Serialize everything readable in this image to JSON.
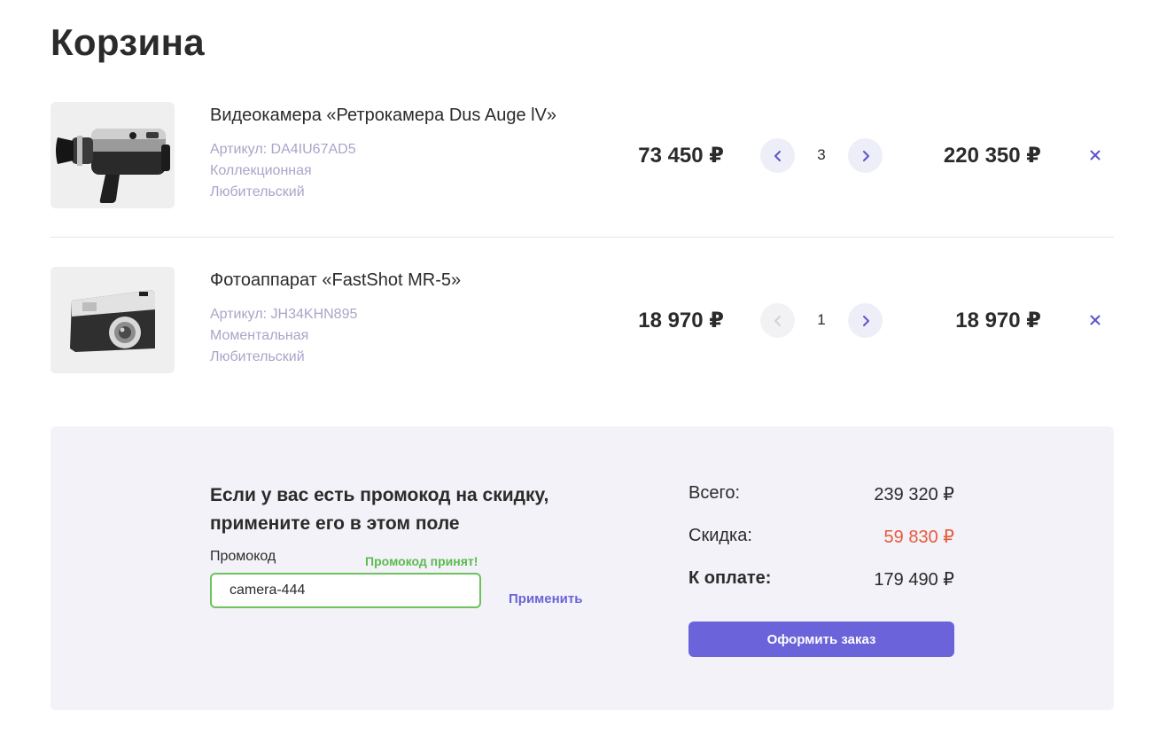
{
  "page": {
    "title": "Корзина"
  },
  "items": [
    {
      "name": "Видеокамера «Ретрокамера Dus Auge lV»",
      "sku": "Артикул: DA4IU67AD5",
      "type": "Коллекционная",
      "level": "Любительский",
      "price": "73 450 ₽",
      "qty": "3",
      "total": "220 350 ₽",
      "thumb_icon": "video-camera-image"
    },
    {
      "name": "Фотоаппарат «FastShot MR-5»",
      "sku": "Артикул: JH34KHN895",
      "type": "Моментальная",
      "level": "Любительский",
      "price": "18 970 ₽",
      "qty": "1",
      "total": "18 970 ₽",
      "thumb_icon": "photo-camera-image"
    }
  ],
  "promo": {
    "heading_line1": "Если у вас есть промокод на скидку,",
    "heading_line2": "примените его в этом поле",
    "label": "Промокод",
    "status": "Промокод принят!",
    "value": "camera-444",
    "apply_label": "Применить"
  },
  "summary": {
    "total_label": "Всего:",
    "total_value": "239 320 ₽",
    "discount_label": "Скидка:",
    "discount_value": "59 830 ₽",
    "pay_label": "К оплате:",
    "pay_value": "179 490 ₽",
    "checkout_label": "Оформить заказ"
  },
  "colors": {
    "accent": "#6b63d9",
    "success": "#5cbb4f",
    "discount": "#e85a3c",
    "muted": "#a8a6c9",
    "panel": "#f2f2f8"
  }
}
